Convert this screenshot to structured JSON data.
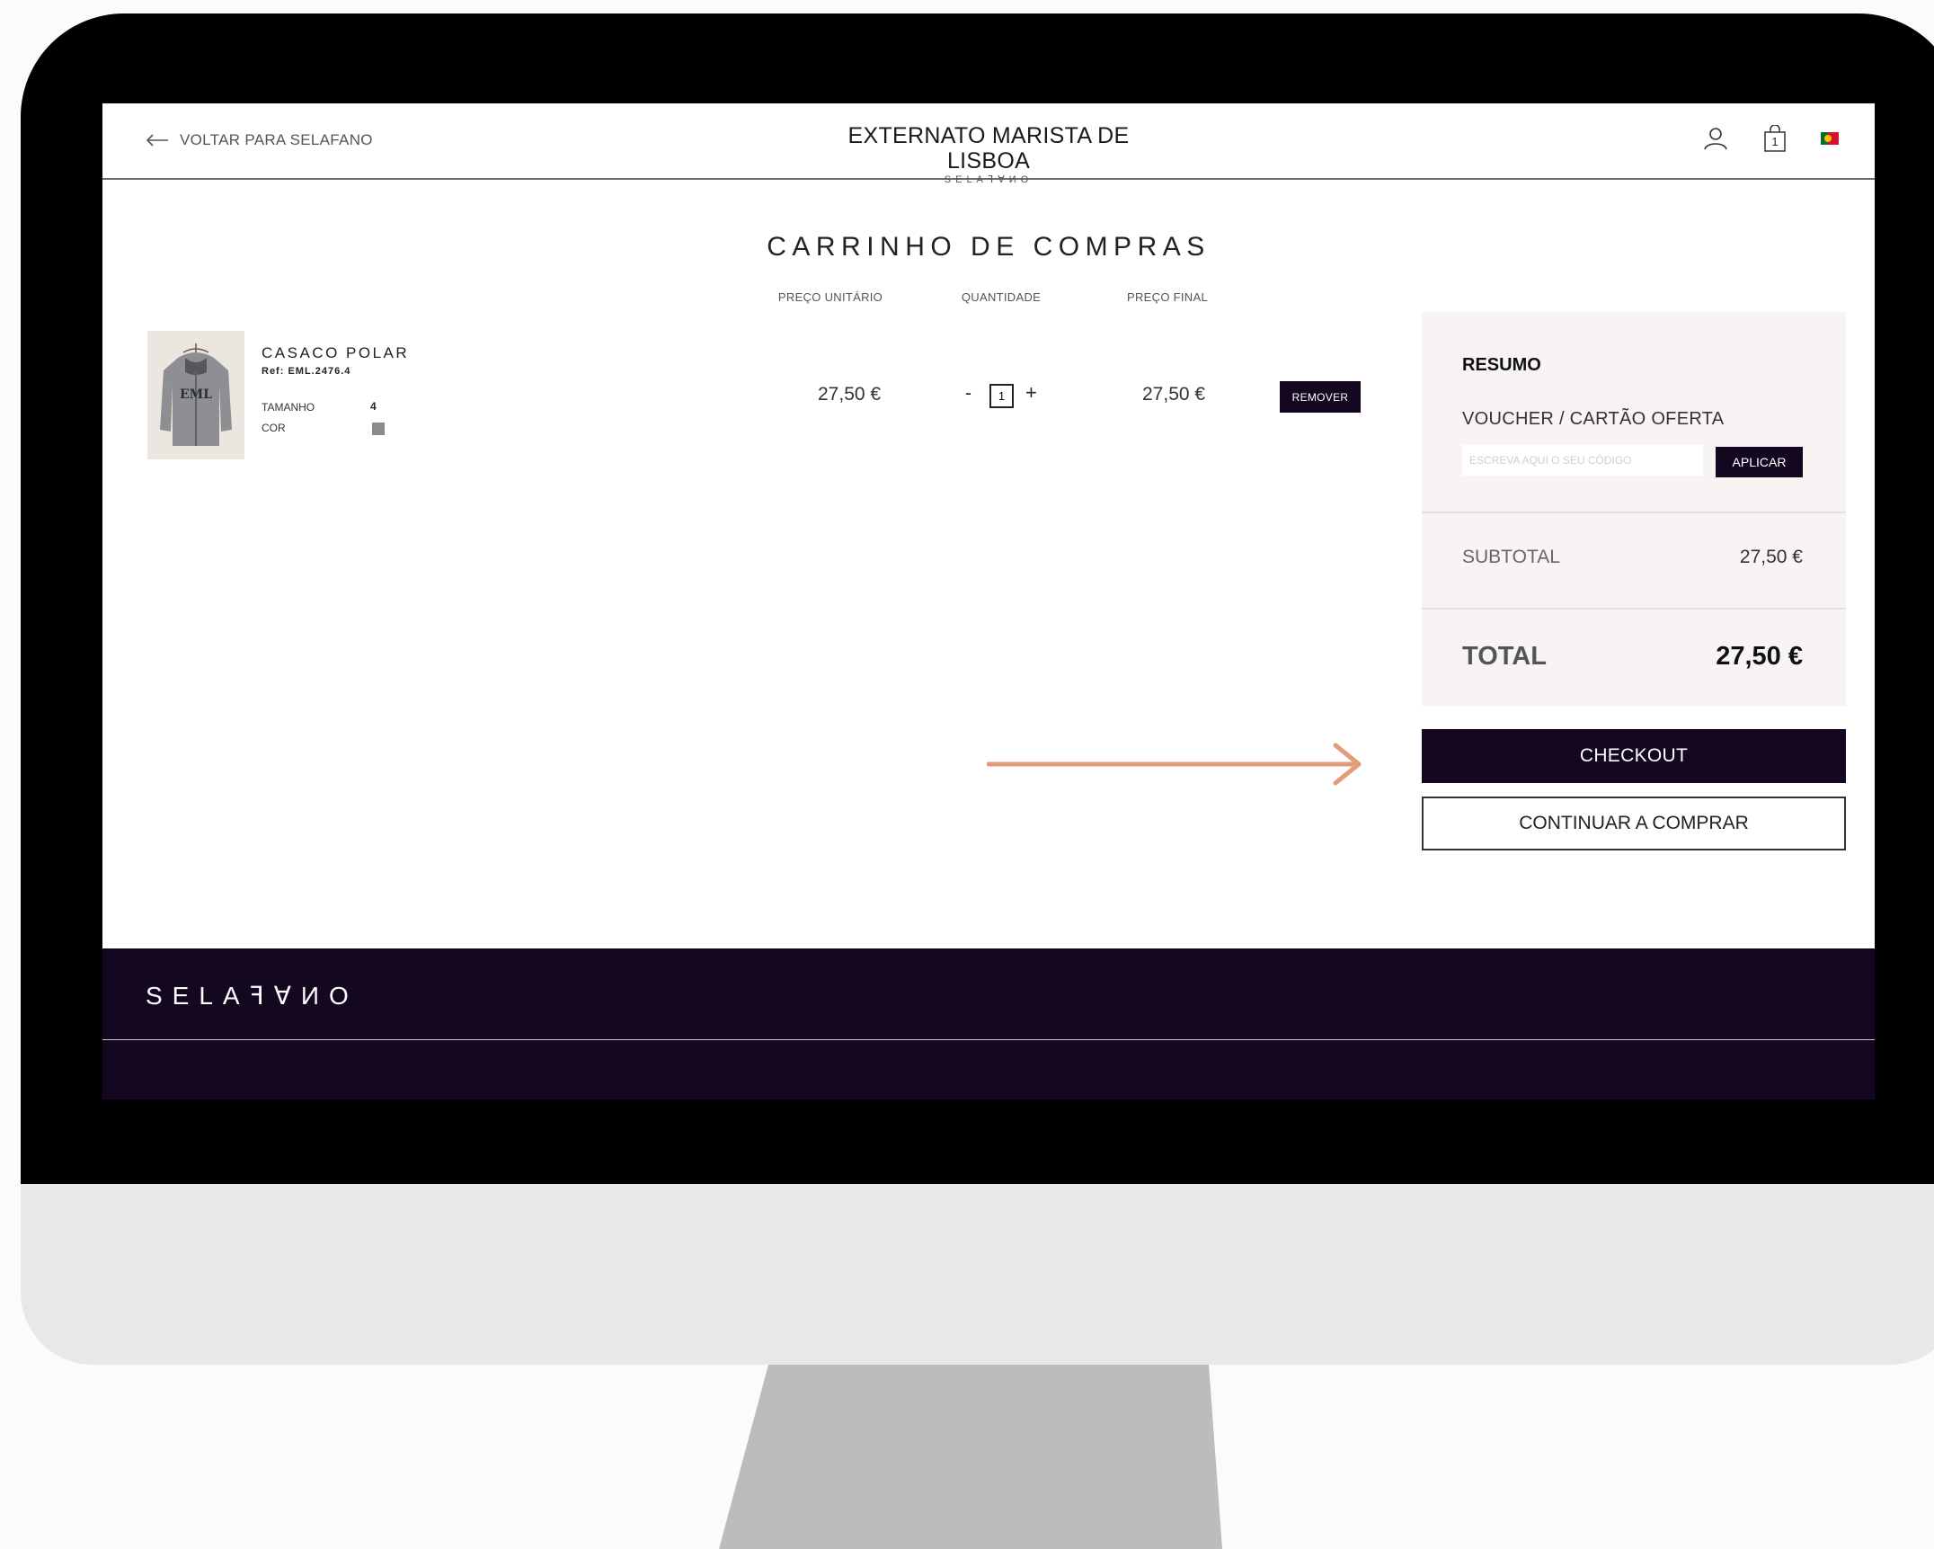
{
  "header": {
    "back_label": "VOLTAR PARA SELAFANO",
    "store_title": "EXTERNATO MARISTA DE LISBOA",
    "store_subtitle": "SELAꟻꓯИO",
    "cart_count": "1"
  },
  "cart": {
    "title": "CARRINHO DE COMPRAS",
    "columns": {
      "unit_price": "PREÇO UNITÁRIO",
      "quantity": "QUANTIDADE",
      "final_price": "PREÇO FINAL"
    },
    "item": {
      "name": "CASACO POLAR",
      "ref": "Ref: EML.2476.4",
      "size_label": "TAMANHO",
      "size_value": "4",
      "color_label": "COR",
      "color_hex": "#8b8b8b",
      "unit_price": "27,50 €",
      "quantity": "1",
      "minus": "-",
      "plus": "+",
      "final_price": "27,50 €",
      "remove_label": "REMOVER"
    }
  },
  "summary": {
    "title": "RESUMO",
    "voucher_label": "VOUCHER / CARTÃO OFERTA",
    "voucher_placeholder": "ESCREVA AQUI O SEU CÓDIGO",
    "apply_label": "APLICAR",
    "subtotal_label": "SUBTOTAL",
    "subtotal_value": "27,50 €",
    "total_label": "TOTAL",
    "total_value": "27,50 €"
  },
  "actions": {
    "checkout_label": "CHECKOUT",
    "continue_label": "CONTINUAR A COMPRAR",
    "arrow_color": "#e19c7c"
  },
  "footer": {
    "logo": "SELAꟻꓯИO"
  },
  "colors": {
    "brand_dark": "#130820",
    "summary_bg": "#f7f4f3"
  }
}
